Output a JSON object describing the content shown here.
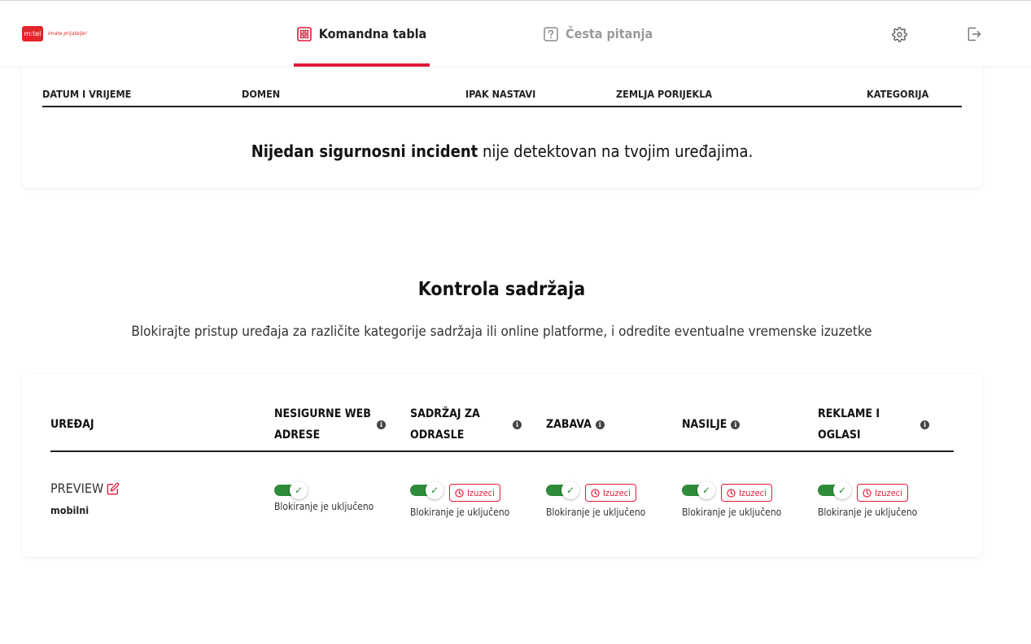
{
  "header": {
    "logo_text": "m:tel",
    "logo_tagline": "Imate prijatelje!",
    "tabs": [
      {
        "label": "Komandna tabla",
        "active": true
      },
      {
        "label": "Česta pitanja",
        "active": false
      }
    ],
    "accent_color": "#e21a37"
  },
  "incidents": {
    "columns": [
      "DATUM I VRIJEME",
      "DOMEN",
      "IPAK NASTAVI",
      "ZEMLJA PORIJEKLA",
      "KATEGORIJA"
    ],
    "empty_bold": "Nijedan sigurnosni incident",
    "empty_rest": " nije detektovan na tvojim uređajima."
  },
  "content_control": {
    "title": "Kontrola sadržaja",
    "description": "Blokirajte pristup uređaja za različite kategorije sadržaja ili online platforme, i odredite eventualne vremenske izuzetke",
    "columns": [
      "UREĐAJ",
      "NESIGURNE WEB ADRESE",
      "SADRŽAJ ZA ODRASLE",
      "ZABAVA",
      "NASILJE",
      "REKLAME I OGLASI"
    ],
    "device": {
      "name": "PREVIEW",
      "type": "mobilni"
    },
    "toggle_color": "#2e8b3a",
    "cells": [
      {
        "enabled": true,
        "status": "Blokiranje je uključeno",
        "button": ""
      },
      {
        "enabled": true,
        "status": "Blokiranje je uključeno",
        "button": "Izuzeci"
      },
      {
        "enabled": true,
        "status": "Blokiranje je uključeno",
        "button": "Izuzeci"
      },
      {
        "enabled": true,
        "status": "Blokiranje je uključeno",
        "button": "Izuzeci"
      },
      {
        "enabled": true,
        "status": "Blokiranje je uključeno",
        "button": "Izuzeci"
      }
    ],
    "info_icon_glyph": "i",
    "check_glyph": "✓"
  }
}
